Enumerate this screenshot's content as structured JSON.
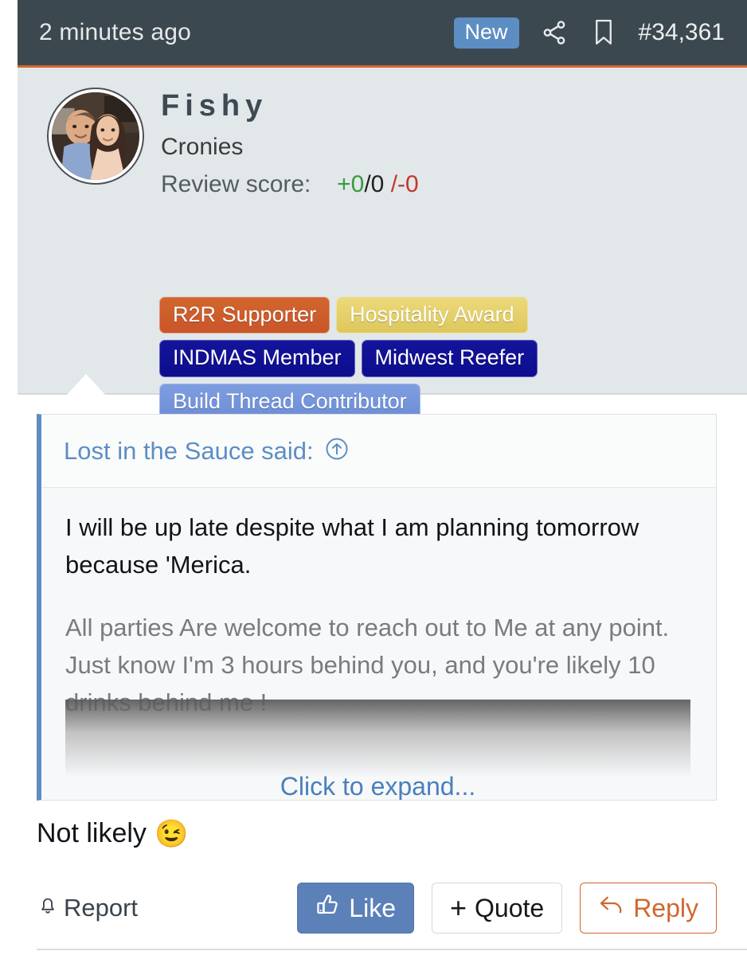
{
  "header": {
    "timestamp": "2 minutes ago",
    "new_badge": "New",
    "share_icon": "share-icon",
    "bookmark_icon": "bookmark-icon",
    "post_number": "#34,361"
  },
  "user": {
    "avatar_icon": "user-avatar-photo",
    "username": "Fishy",
    "title": "Cronies",
    "review_label": "Review score:",
    "review_positive": "+0",
    "review_neutral": "/0",
    "review_negative": "/-0",
    "badges": [
      {
        "label": "R2R Supporter",
        "style": "badge-orange",
        "color": "#d2662e"
      },
      {
        "label": "Hospitality Award",
        "style": "badge-yellow",
        "color": "#ecd97a"
      },
      {
        "label": "INDMAS Member",
        "style": "badge-navy",
        "color": "#14149c"
      },
      {
        "label": "Midwest Reefer",
        "style": "badge-navy",
        "color": "#14149c"
      },
      {
        "label": "Build Thread Contributor",
        "style": "badge-blue",
        "color": "#7f9ee0"
      }
    ]
  },
  "quote": {
    "attribution": "Lost in the Sauce said:",
    "jump_icon": "circle-up-arrow-icon",
    "paragraph_1": "I will be up late despite what I am planning tomorrow because 'Merica.",
    "paragraph_2": "All parties Are welcome to reach out to Me at any point. Just know I'm 3 hours behind you, and you're likely 10 drinks behind me !",
    "expand_label": "Click to expand..."
  },
  "post": {
    "message": "Not likely",
    "emoji": "😉"
  },
  "actions": {
    "report_label": "Report",
    "report_icon": "bell-icon",
    "like_label": "Like",
    "like_icon": "thumbs-up-icon",
    "quote_plus": "+",
    "quote_label": "Quote",
    "reply_label": "Reply",
    "reply_icon": "reply-arrow-icon"
  },
  "colors": {
    "header_bg": "#3c4850",
    "accent_orange": "#d2662e",
    "accent_blue": "#5c8ec4",
    "card_bg": "#e2e7ea",
    "like_blue": "#5c80b8"
  }
}
